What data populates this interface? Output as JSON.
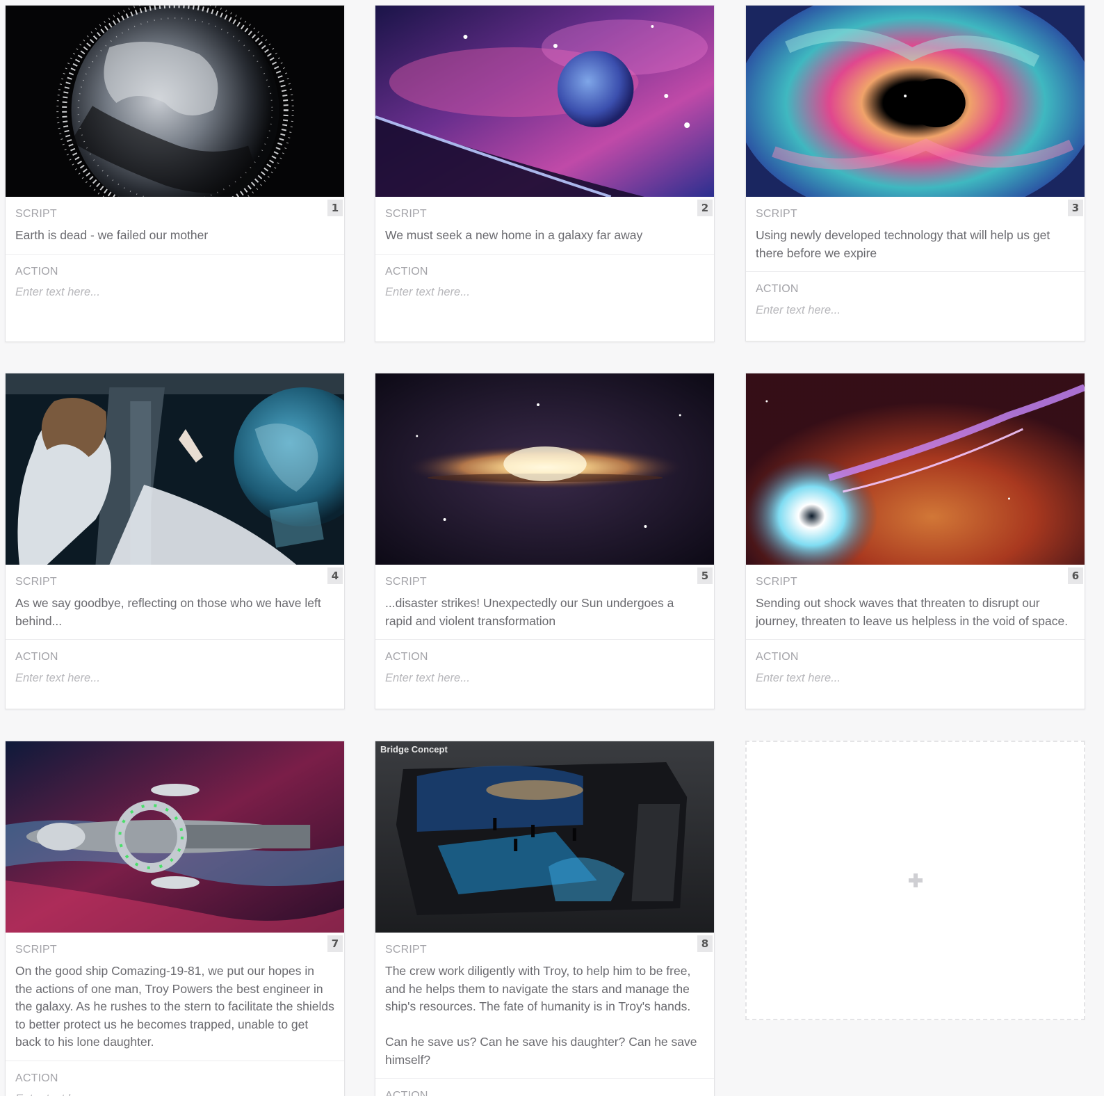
{
  "section_labels": {
    "script": "SCRIPT",
    "action": "ACTION"
  },
  "action_placeholder": "Enter text here...",
  "panels": [
    {
      "number": "1",
      "image": "earth-space-debris-image",
      "script": "Earth is dead - we failed our mother",
      "action": ""
    },
    {
      "number": "2",
      "image": "nebula-planet-image",
      "script": "We must seek a new home in a galaxy far away",
      "action": ""
    },
    {
      "number": "3",
      "image": "colorful-black-hole-image",
      "script": "Using newly developed technology that will help us get there before we expire",
      "action": ""
    },
    {
      "number": "4",
      "image": "woman-at-spaceship-window-image",
      "script": "As we say goodbye, reflecting on those who we have left behind...",
      "action": ""
    },
    {
      "number": "5",
      "image": "galaxy-disk-image",
      "script": "...disaster strikes! Unexpectedly our Sun undergoes a rapid and violent transformation",
      "action": ""
    },
    {
      "number": "6",
      "image": "black-hole-star-jet-image",
      "script": "Sending out shock waves that threaten to disrupt our journey, threaten to leave us helpless in the void of space.",
      "action": ""
    },
    {
      "number": "7",
      "image": "spaceship-nebula-image",
      "script": "On the good ship Comazing-19-81, we put our hopes in the actions of one man, Troy Powers the best engineer in the galaxy. As he rushes to the stern to facilitate the shields to better protect us he becomes trapped, unable to get back to his lone daughter.",
      "action": ""
    },
    {
      "number": "8",
      "image": "bridge-concept-image",
      "image_caption": "Bridge Concept",
      "script": "The crew work diligently with Troy, to help him to be free, and he helps them to navigate the stars and manage the ship's resources. The fate of humanity is in Troy's hands.\n\nCan he save us? Can he save his daughter? Can he save himself?",
      "action": ""
    }
  ],
  "add_panel": {
    "icon": "plus-icon"
  }
}
